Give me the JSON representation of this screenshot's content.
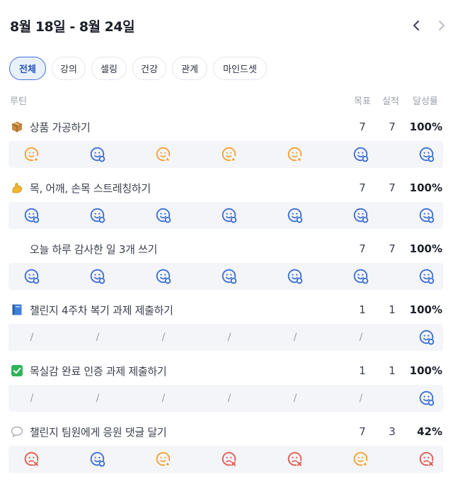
{
  "header": {
    "title": "8월 18일 - 8월 24일",
    "prev_icon": "chevron-left-icon",
    "next_icon": "chevron-right-icon"
  },
  "chips": [
    {
      "label": "전체",
      "active": true
    },
    {
      "label": "강의",
      "active": false
    },
    {
      "label": "셀링",
      "active": false
    },
    {
      "label": "건강",
      "active": false
    },
    {
      "label": "관계",
      "active": false
    },
    {
      "label": "마인드셋",
      "active": false
    }
  ],
  "columns": {
    "routine": "루틴",
    "goal": "목표",
    "actual": "실적",
    "rate": "달성률"
  },
  "colors": {
    "done": "#3b6fd4",
    "partial": "#f2a134",
    "missed": "#e05a4f",
    "active_chip": "#3e6fd8"
  },
  "routines": [
    {
      "emoji": "package-icon",
      "title": "상품 가공하기",
      "goal": "7",
      "actual": "7",
      "rate": "100%",
      "days": [
        "partial",
        "done",
        "partial",
        "partial",
        "partial",
        "done",
        "done"
      ]
    },
    {
      "emoji": "flexed-biceps-icon",
      "title": "목, 어깨, 손목 스트레칭하기",
      "goal": "7",
      "actual": "7",
      "rate": "100%",
      "days": [
        "done",
        "done",
        "done",
        "done",
        "done",
        "done",
        "done"
      ]
    },
    {
      "emoji": "",
      "title": "오늘 하루 감사한 일 3개 쓰기",
      "goal": "7",
      "actual": "7",
      "rate": "100%",
      "days": [
        "done",
        "done",
        "done",
        "done",
        "done",
        "done",
        "done"
      ]
    },
    {
      "emoji": "blue-book-icon",
      "title": "챌린지 4주차 복기 과제 제출하기",
      "goal": "1",
      "actual": "1",
      "rate": "100%",
      "days": [
        "none",
        "none",
        "none",
        "none",
        "none",
        "none",
        "done"
      ]
    },
    {
      "emoji": "check-mark-box-icon",
      "title": "목실감 완료 인증 과제 제출하기",
      "goal": "1",
      "actual": "1",
      "rate": "100%",
      "days": [
        "none",
        "none",
        "none",
        "none",
        "none",
        "none",
        "done"
      ]
    },
    {
      "emoji": "speech-balloon-icon",
      "title": "챌린지 팀원에게 응원 댓글 달기",
      "goal": "7",
      "actual": "3",
      "rate": "42%",
      "days": [
        "missed",
        "done",
        "partial",
        "missed",
        "missed",
        "partial",
        "missed"
      ]
    }
  ],
  "slash_text": "/"
}
